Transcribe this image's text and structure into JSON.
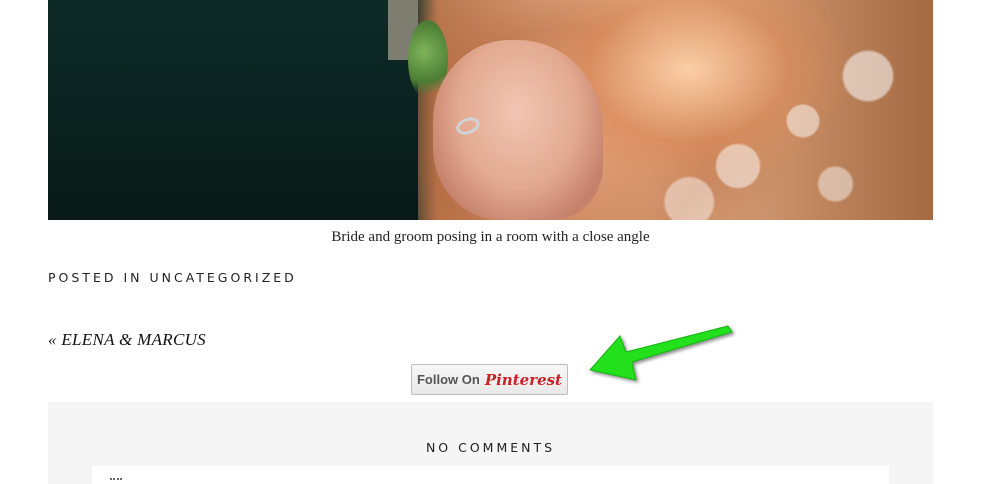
{
  "photo": {
    "alt": "Bride and groom posing in a room with a close angle"
  },
  "caption": "Bride and groom posing in a room with a close angle",
  "post_meta": {
    "posted_in_label": "Posted in",
    "category": "Uncategorized"
  },
  "navigation": {
    "previous_link": "« ELENA & MARCUS"
  },
  "pinterest": {
    "follow_label": "Follow On",
    "brand_label": "Pinterest"
  },
  "annotation": {
    "arrow_color": "#22e01e"
  },
  "comments": {
    "heading": "No Comments"
  }
}
